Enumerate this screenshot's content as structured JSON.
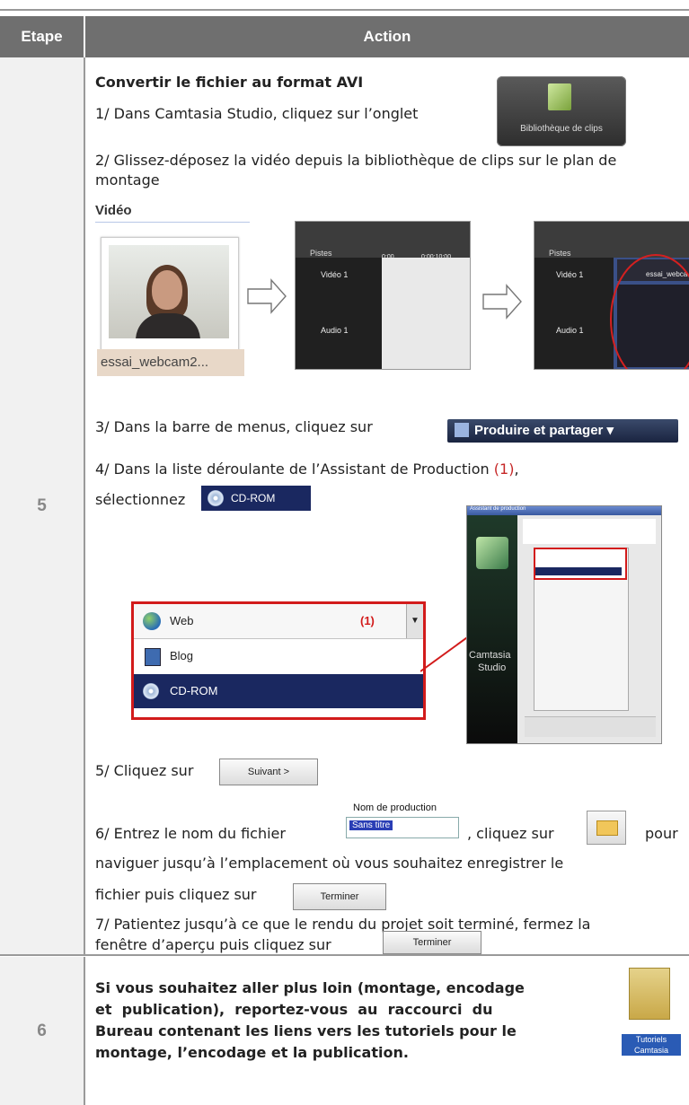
{
  "header": {
    "etape": "Etape",
    "action": "Action"
  },
  "step5": {
    "number": "5",
    "title": "Convertir le fichier au format AVI",
    "s1": "1/ Dans Camtasia Studio, cliquez sur l’onglet",
    "biblio_label": "Bibliothèque de clips",
    "s2": "2/ Glissez-déposez la vidéo depuis la bibliothèque de clips sur le plan de montage",
    "video_title": "Vidéo",
    "clip_name": "essai_webcam2...",
    "timeline": {
      "pistes": "Pistes",
      "video1": "Vidéo 1",
      "audio1": "Audio 1",
      "t0": "0:00",
      "t1": "0:00:10;00",
      "clip": "essai_webca"
    },
    "s3": "3/ Dans la barre de menus, cliquez sur",
    "produire": "Produire et partager",
    "s4a": "4/ Dans la liste déroulante de l’Assistant de Production",
    "s4_ref": "(1)",
    "s4b": "sélectionnez",
    "cdrom": "CD-ROM",
    "dropdown": {
      "web": "Web",
      "marker": "(1)",
      "blog": "Blog",
      "cdrom": "CD-ROM"
    },
    "window": {
      "title": "Assistant de production",
      "brand1": "Camtasia",
      "brand2": "Studio"
    },
    "s5": "5/ Cliquez sur",
    "suivant": "Suivant >",
    "s6a": "6/ Entrez le nom du fichier",
    "nom_label": "Nom de production",
    "nom_value": "Sans titre",
    "s6b": ", cliquez sur",
    "s6c": "pour",
    "s6d": "naviguer jusqu’à l’emplacement où vous souhaitez enregistrer le",
    "s6e": "fichier puis cliquez sur",
    "terminer": "Terminer",
    "s7a": "7/ Patientez jusqu’à ce que le rendu du projet soit terminé, fermez la",
    "s7b": "fenêtre d’aperçu puis cliquez sur"
  },
  "step6": {
    "number": "6",
    "l1": "Si vous souhaitez aller plus loin (montage, encodage",
    "l2": "et  publication),  reportez-vous  au  raccourci  du",
    "l3": "Bureau contenant les liens vers les tutoriels pour le",
    "l4": "montage, l’encodage et la publication.",
    "icon_label": "Tutoriels Camtasia"
  }
}
